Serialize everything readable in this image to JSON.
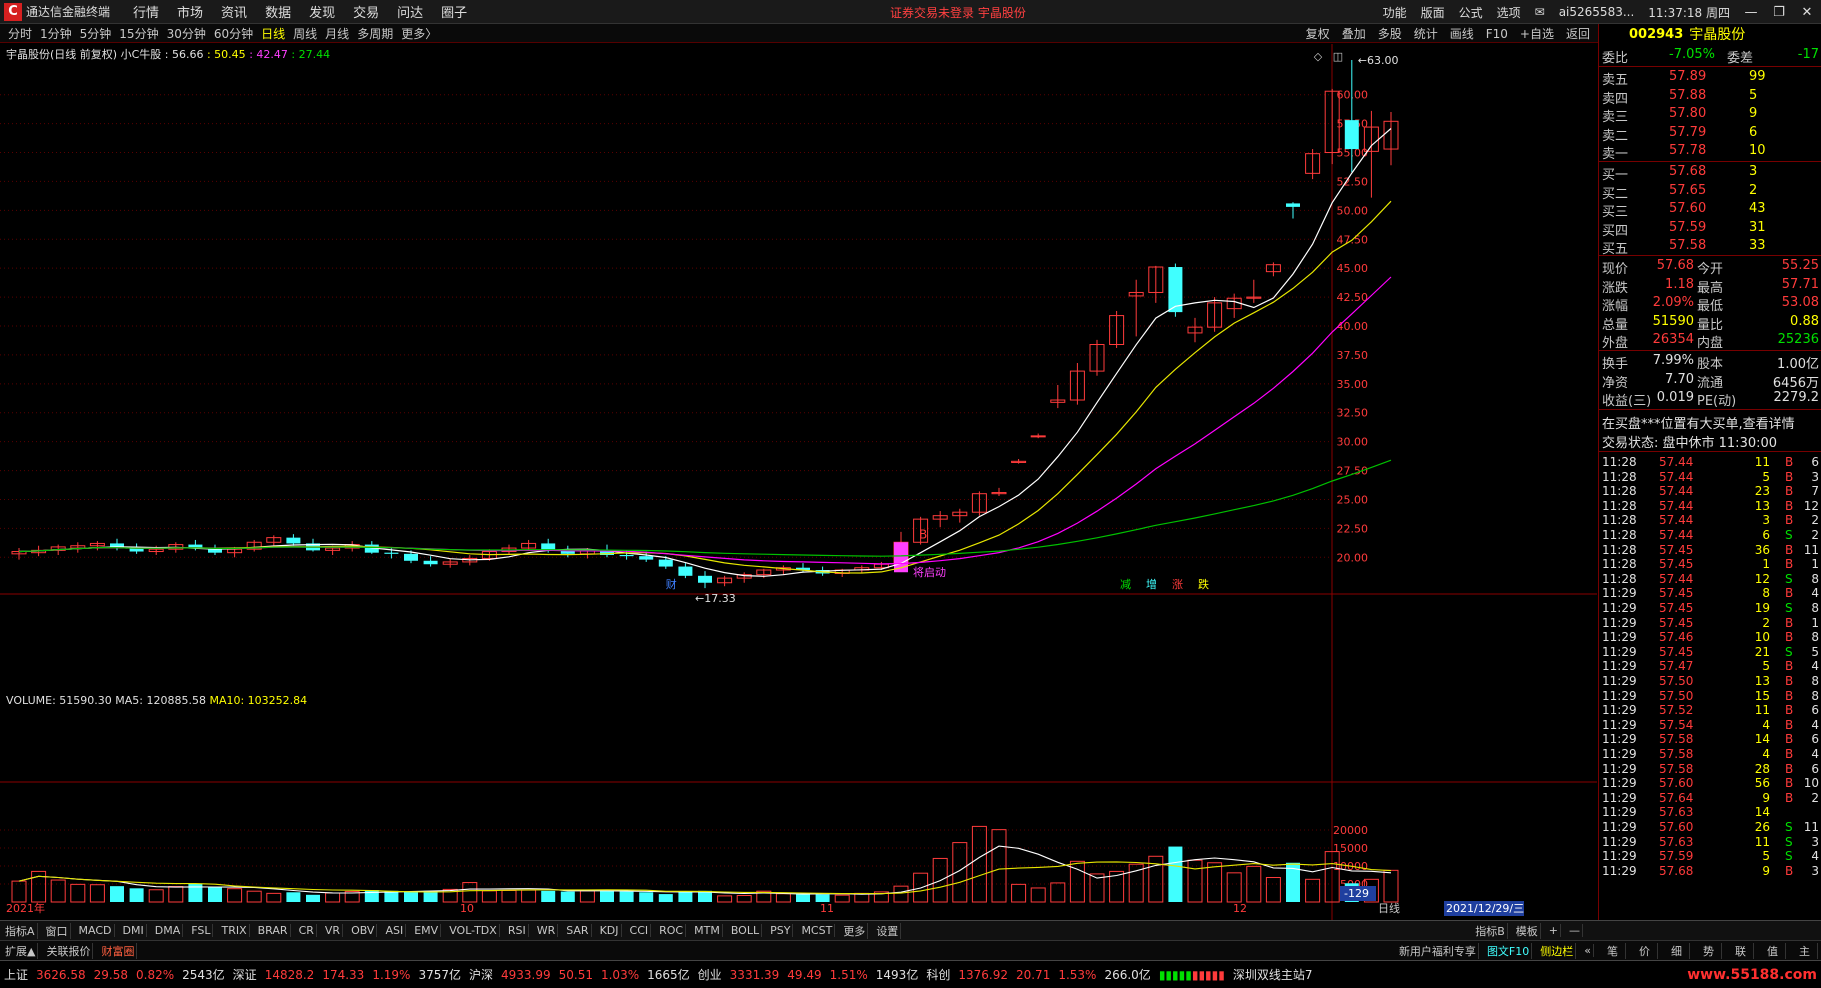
{
  "app": {
    "logo": "C",
    "title": "通达信金融终端",
    "menus": [
      "行情",
      "市场",
      "资讯",
      "数据",
      "发现",
      "交易",
      "问达",
      "圈子"
    ],
    "notice": "证券交易未登录  宇晶股份",
    "right_menus": [
      "功能",
      "版面",
      "公式",
      "选项"
    ],
    "user": "ai5265583...",
    "time": "11:37:18 周四",
    "win_min": "—",
    "win_max": "❐",
    "win_close": "✕"
  },
  "periods": [
    "分时",
    "1分钟",
    "5分钟",
    "15分钟",
    "30分钟",
    "60分钟",
    "日线",
    "周线",
    "月线",
    "多周期",
    "更多〉"
  ],
  "active_period": "日线",
  "tools": [
    "复权",
    "叠加",
    "多股",
    "统计",
    "画线",
    "F10",
    "+自选",
    "返回"
  ],
  "stock": {
    "code": "002943",
    "name": "宇晶股份"
  },
  "legend1": {
    "name": "宇晶股份(日线 前复权)",
    "ind": "小C牛股",
    "v1": ": 56.66",
    "v2": ": 50.45",
    "v3": ": 42.47",
    "v4": ": 27.44"
  },
  "legend2": {
    "vol": "VOLUME: 51590.30",
    "ma5": "MA5: 120885.58",
    "ma10": "MA10: 103252.84"
  },
  "annot": {
    "high": "63.00",
    "low": "17.33",
    "launch": "将启动",
    "b": "B",
    "cai": "财",
    "flags": [
      "减",
      "增",
      "涨",
      "跌"
    ]
  },
  "x_labels": [
    "2021年",
    "10",
    "11",
    "12"
  ],
  "date_box": "2021/12/29/三",
  "vol_readout": "-129",
  "period_label": "日线",
  "chart_data": [
    {
      "type": "candlestick",
      "title": "宇晶股份(日线 前复权)",
      "ylim": [
        17,
        63
      ],
      "y_ticks": [
        20.0,
        22.5,
        25.0,
        27.5,
        30.0,
        32.5,
        35.0,
        37.5,
        40.0,
        42.5,
        45.0,
        47.5,
        50.0,
        52.5,
        55.0,
        57.5,
        60.0
      ],
      "ohlc": [
        [
          20.3,
          20.8,
          19.8,
          20.5
        ],
        [
          20.4,
          21.0,
          20.1,
          20.6
        ],
        [
          20.6,
          21.1,
          20.2,
          20.9
        ],
        [
          20.8,
          21.3,
          20.4,
          21.0
        ],
        [
          21.0,
          21.4,
          20.6,
          21.2
        ],
        [
          21.2,
          21.6,
          20.6,
          20.8
        ],
        [
          20.8,
          21.2,
          20.3,
          20.5
        ],
        [
          20.5,
          21.0,
          20.2,
          20.7
        ],
        [
          20.7,
          21.3,
          20.4,
          21.1
        ],
        [
          21.1,
          21.5,
          20.6,
          20.8
        ],
        [
          20.8,
          21.1,
          20.2,
          20.4
        ],
        [
          20.4,
          20.9,
          20.0,
          20.7
        ],
        [
          20.7,
          21.5,
          20.5,
          21.3
        ],
        [
          21.3,
          21.9,
          21.0,
          21.7
        ],
        [
          21.7,
          22.0,
          21.0,
          21.2
        ],
        [
          21.2,
          21.6,
          20.5,
          20.6
        ],
        [
          20.6,
          21.0,
          20.2,
          20.8
        ],
        [
          20.8,
          21.4,
          20.5,
          21.1
        ],
        [
          21.1,
          21.4,
          20.3,
          20.4
        ],
        [
          20.4,
          20.8,
          19.9,
          20.3
        ],
        [
          20.3,
          20.6,
          19.5,
          19.7
        ],
        [
          19.7,
          20.1,
          19.2,
          19.4
        ],
        [
          19.4,
          19.9,
          19.1,
          19.6
        ],
        [
          19.6,
          20.2,
          19.3,
          19.9
        ],
        [
          19.9,
          20.7,
          19.7,
          20.5
        ],
        [
          20.5,
          21.1,
          20.2,
          20.8
        ],
        [
          20.8,
          21.5,
          20.6,
          21.2
        ],
        [
          21.2,
          21.6,
          20.4,
          20.6
        ],
        [
          20.6,
          21.0,
          20.0,
          20.3
        ],
        [
          20.3,
          20.8,
          19.9,
          20.6
        ],
        [
          20.6,
          21.1,
          20.0,
          20.2
        ],
        [
          20.2,
          20.6,
          19.8,
          20.1
        ],
        [
          20.1,
          20.5,
          19.6,
          19.8
        ],
        [
          19.8,
          20.1,
          19.0,
          19.2
        ],
        [
          19.2,
          19.5,
          18.2,
          18.4
        ],
        [
          18.4,
          18.8,
          17.33,
          17.8
        ],
        [
          17.8,
          18.4,
          17.5,
          18.2
        ],
        [
          18.2,
          18.7,
          17.8,
          18.5
        ],
        [
          18.5,
          19.0,
          18.2,
          18.9
        ],
        [
          18.9,
          19.3,
          18.5,
          19.1
        ],
        [
          19.1,
          19.5,
          18.7,
          18.9
        ],
        [
          18.9,
          19.2,
          18.4,
          18.6
        ],
        [
          18.6,
          19.0,
          18.3,
          18.9
        ],
        [
          18.9,
          19.3,
          18.6,
          19.1
        ],
        [
          19.1,
          19.6,
          18.9,
          19.4
        ],
        [
          19.4,
          22.2,
          19.3,
          21.3
        ],
        [
          21.3,
          23.5,
          21.1,
          23.3
        ],
        [
          23.3,
          24.0,
          22.6,
          23.6
        ],
        [
          23.6,
          24.2,
          23.0,
          23.9
        ],
        [
          23.9,
          25.7,
          23.6,
          25.5
        ],
        [
          25.5,
          26.0,
          25.3,
          25.6
        ],
        [
          28.2,
          28.5,
          28.1,
          28.3
        ],
        [
          30.5,
          30.7,
          30.3,
          30.5
        ],
        [
          33.4,
          34.9,
          32.9,
          33.6
        ],
        [
          33.6,
          36.8,
          33.2,
          36.1
        ],
        [
          36.1,
          38.8,
          35.7,
          38.4
        ],
        [
          38.4,
          41.3,
          38.1,
          40.9
        ],
        [
          42.6,
          44.0,
          39.1,
          42.9
        ],
        [
          42.9,
          45.2,
          42.0,
          45.1
        ],
        [
          45.1,
          45.4,
          40.8,
          41.2
        ],
        [
          39.4,
          40.7,
          38.6,
          39.9
        ],
        [
          39.9,
          42.5,
          39.5,
          42.0
        ],
        [
          41.5,
          42.8,
          40.7,
          42.4
        ],
        [
          42.4,
          44.0,
          42.0,
          42.5
        ],
        [
          44.7,
          45.5,
          44.3,
          45.3
        ],
        [
          50.6,
          50.7,
          49.3,
          50.3
        ],
        [
          53.2,
          55.3,
          52.7,
          54.9
        ],
        [
          55.0,
          60.5,
          54.0,
          60.3
        ],
        [
          57.8,
          63.0,
          53.3,
          55.3
        ],
        [
          55.1,
          58.6,
          51.1,
          57.2
        ],
        [
          55.3,
          58.5,
          53.9,
          57.7
        ]
      ],
      "ma_series": [
        {
          "name": "56.66"
        },
        {
          "name": "50.45"
        },
        {
          "name": "42.47"
        },
        {
          "name": "27.44"
        }
      ]
    },
    {
      "type": "bar",
      "title": "VOLUME",
      "ylim": [
        0,
        30000
      ],
      "y_ticks": [
        5000,
        10000,
        15000,
        20000
      ],
      "series": [
        {
          "name": "VOLUME",
          "values": [
            5800,
            8500,
            6100,
            4900,
            4800,
            4400,
            3800,
            3400,
            4300,
            5100,
            4200,
            3700,
            3000,
            2400,
            2700,
            2000,
            2500,
            2900,
            3300,
            3100,
            2800,
            3100,
            3500,
            5400,
            3100,
            3200,
            3300,
            3100,
            2900,
            3100,
            3200,
            2900,
            2700,
            2200,
            3000,
            3100,
            1700,
            1800,
            3000,
            2300,
            2200,
            2100,
            1900,
            2400,
            2800,
            4400,
            8000,
            12100,
            16500,
            21000,
            20100,
            4900,
            3900,
            5300,
            11300,
            7800,
            8500,
            10500,
            12700,
            15400,
            11600,
            10900,
            8100,
            9900,
            6800,
            10900,
            6300,
            14000,
            5200,
            6300,
            8800
          ]
        },
        {
          "name": "MA5: 120885.58"
        },
        {
          "name": "MA10: 103252.84"
        }
      ]
    }
  ],
  "panel": {
    "wei": {
      "l1": "委比",
      "v1": "-7.05%",
      "l2": "委差",
      "v2": "-17"
    },
    "sell": [
      {
        "l": "卖五",
        "p": "57.89",
        "q": "99"
      },
      {
        "l": "卖四",
        "p": "57.88",
        "q": "5"
      },
      {
        "l": "卖三",
        "p": "57.80",
        "q": "9"
      },
      {
        "l": "卖二",
        "p": "57.79",
        "q": "6"
      },
      {
        "l": "卖一",
        "p": "57.78",
        "q": "10"
      }
    ],
    "buy": [
      {
        "l": "买一",
        "p": "57.68",
        "q": "3"
      },
      {
        "l": "买二",
        "p": "57.65",
        "q": "2"
      },
      {
        "l": "买三",
        "p": "57.60",
        "q": "43"
      },
      {
        "l": "买四",
        "p": "57.59",
        "q": "31"
      },
      {
        "l": "买五",
        "p": "57.58",
        "q": "33"
      }
    ],
    "quote": [
      {
        "l1": "现价",
        "v1": "57.68",
        "l2": "今开",
        "v2": "55.25"
      },
      {
        "l1": "涨跌",
        "v1": "1.18",
        "l2": "最高",
        "v2": "57.71"
      },
      {
        "l1": "涨幅",
        "v1": "2.09%",
        "l2": "最低",
        "v2": "53.08"
      },
      {
        "l1": "总量",
        "v1": "51590",
        "l2": "量比",
        "v2": "0.88"
      },
      {
        "l1": "外盘",
        "v1": "26354",
        "l2": "内盘",
        "v2": "25236"
      }
    ],
    "fin": [
      {
        "l1": "换手",
        "v1": "7.99%",
        "l2": "股本",
        "v2": "1.00亿"
      },
      {
        "l1": "净资",
        "v1": "7.70",
        "l2": "流通",
        "v2": "6456万"
      },
      {
        "l1": "收益(三)",
        "v1": "0.019",
        "l2": "PE(动)",
        "v2": "2279.2"
      }
    ],
    "info1": "在买盘***位置有大买单,查看详情",
    "info2": "交易状态: 盘中休市 11:30:00",
    "ticks": [
      [
        "11:28",
        "57.44",
        "11",
        "B",
        "6"
      ],
      [
        "11:28",
        "57.44",
        "5",
        "B",
        "3"
      ],
      [
        "11:28",
        "57.44",
        "23",
        "B",
        "7"
      ],
      [
        "11:28",
        "57.44",
        "13",
        "B",
        "12"
      ],
      [
        "11:28",
        "57.44",
        "3",
        "B",
        "2"
      ],
      [
        "11:28",
        "57.44",
        "6",
        "S",
        "2"
      ],
      [
        "11:28",
        "57.45",
        "36",
        "B",
        "11"
      ],
      [
        "11:28",
        "57.45",
        "1",
        "B",
        "1"
      ],
      [
        "11:28",
        "57.44",
        "12",
        "S",
        "8"
      ],
      [
        "11:29",
        "57.45",
        "8",
        "B",
        "4"
      ],
      [
        "11:29",
        "57.45",
        "19",
        "S",
        "8"
      ],
      [
        "11:29",
        "57.45",
        "2",
        "B",
        "1"
      ],
      [
        "11:29",
        "57.46",
        "10",
        "B",
        "8"
      ],
      [
        "11:29",
        "57.45",
        "21",
        "S",
        "5"
      ],
      [
        "11:29",
        "57.47",
        "5",
        "B",
        "4"
      ],
      [
        "11:29",
        "57.50",
        "13",
        "B",
        "8"
      ],
      [
        "11:29",
        "57.50",
        "15",
        "B",
        "8"
      ],
      [
        "11:29",
        "57.52",
        "11",
        "B",
        "6"
      ],
      [
        "11:29",
        "57.54",
        "4",
        "B",
        "4"
      ],
      [
        "11:29",
        "57.58",
        "14",
        "B",
        "6"
      ],
      [
        "11:29",
        "57.58",
        "4",
        "B",
        "4"
      ],
      [
        "11:29",
        "57.58",
        "28",
        "B",
        "6"
      ],
      [
        "11:29",
        "57.60",
        "56",
        "B",
        "10"
      ],
      [
        "11:29",
        "57.64",
        "9",
        "B",
        "2"
      ],
      [
        "11:29",
        "57.63",
        "14",
        "",
        ""
      ],
      [
        "11:29",
        "57.60",
        "26",
        "S",
        "11"
      ],
      [
        "11:29",
        "57.63",
        "11",
        "S",
        "3"
      ],
      [
        "11:29",
        "57.59",
        "5",
        "S",
        "4"
      ],
      [
        "11:29",
        "57.68",
        "9",
        "B",
        "3"
      ]
    ]
  },
  "bottom_tabs": [
    "指标A",
    "窗口",
    "MACD",
    "DMI",
    "DMA",
    "FSL",
    "TRIX",
    "BRAR",
    "CR",
    "VR",
    "OBV",
    "ASI",
    "EMV",
    "VOL-TDX",
    "RSI",
    "WR",
    "SAR",
    "KDJ",
    "CCI",
    "ROC",
    "MTM",
    "BOLL",
    "PSY",
    "MCST",
    "更多",
    "设置"
  ],
  "bottom_right": [
    "指标B",
    "模板",
    "+",
    "—"
  ],
  "bottom2_left": [
    "扩展▲",
    "关联报价",
    "财富圈"
  ],
  "bottom2_right": [
    "新用户福利专享",
    "图文F10",
    "侧边栏",
    "«"
  ],
  "panel_tabs": [
    "笔",
    "价",
    "细",
    "势",
    "联",
    "值",
    "主"
  ],
  "status": [
    {
      "n": "上证",
      "p": "3626.58",
      "c": "29.58",
      "r": "0.82%",
      "v": "2543亿"
    },
    {
      "n": "深证",
      "p": "14828.2",
      "c": "174.33",
      "r": "1.19%",
      "v": "3757亿"
    },
    {
      "n": "沪深",
      "p": "4933.99",
      "c": "50.51",
      "r": "1.03%",
      "v": "1665亿"
    },
    {
      "n": "创业",
      "p": "3331.39",
      "c": "49.49",
      "r": "1.51%",
      "v": "1493亿"
    },
    {
      "n": "科创",
      "p": "1376.92",
      "c": "20.71",
      "r": "1.53%",
      "v": "266.0亿"
    }
  ],
  "status_server": "深圳双线主站7",
  "watermark": "www.55188.com",
  "colors": {
    "up": "#ff3b3b",
    "down": "#40ffff",
    "ma1": "#ffffff",
    "ma2": "#e6e600",
    "ma3": "#ff00ff",
    "ma4": "#00c000",
    "grid": "#5a0000"
  }
}
